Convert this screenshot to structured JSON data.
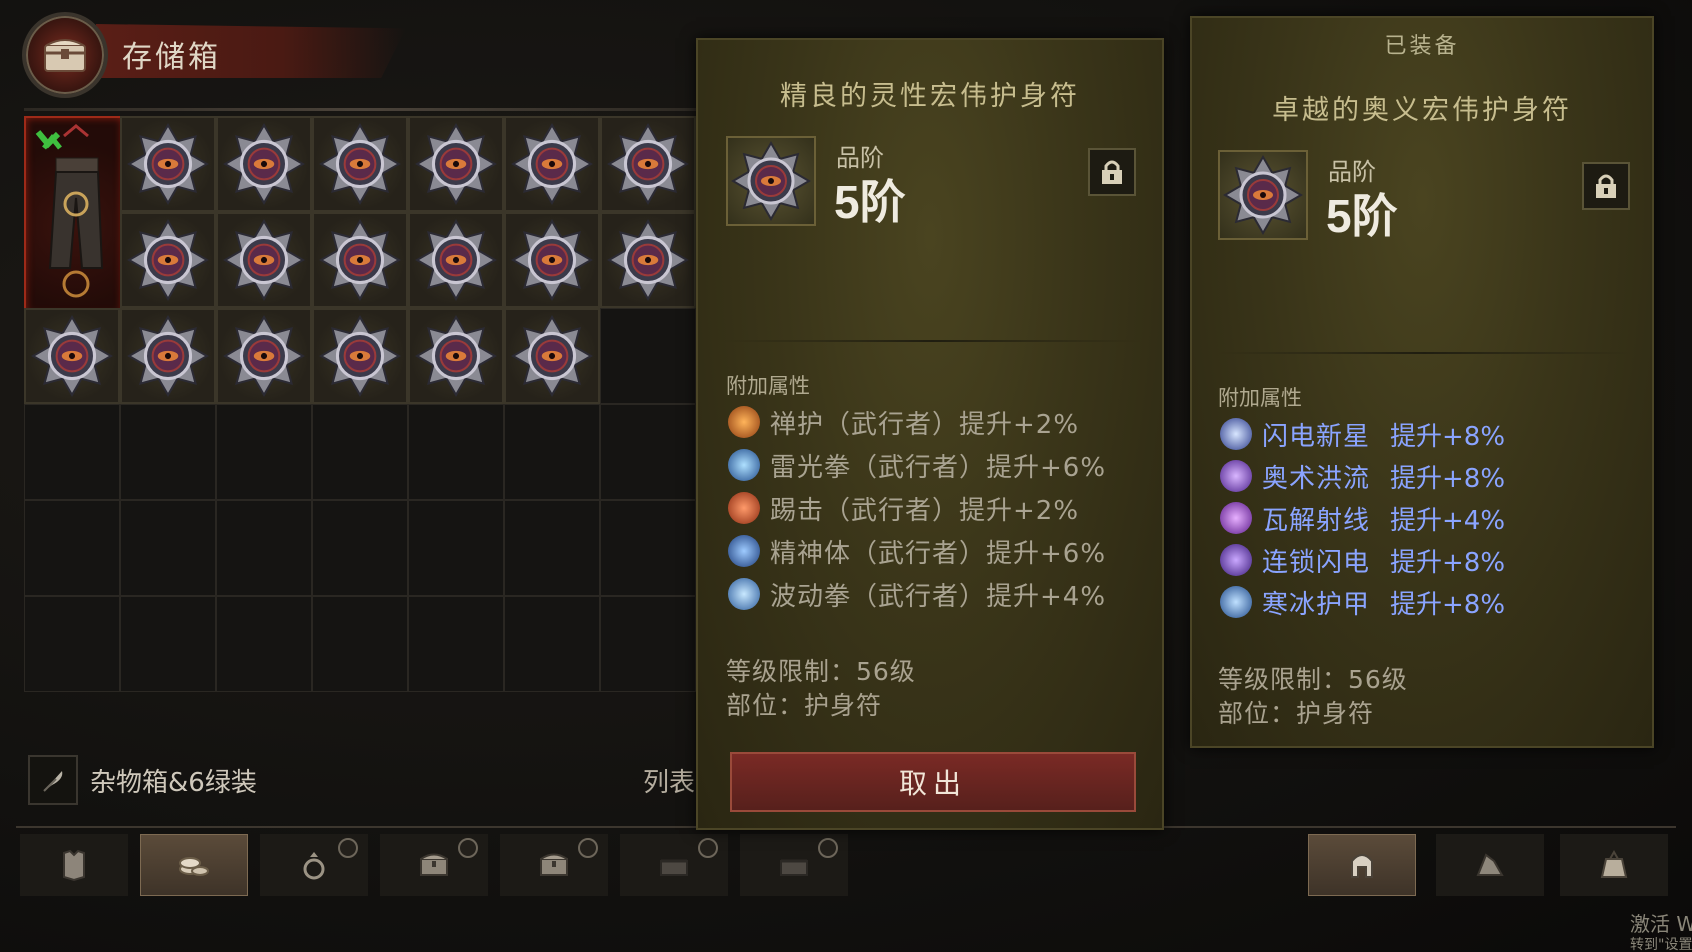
{
  "stash": {
    "title": "存储箱",
    "tab_name": "杂物箱&6绿装",
    "list_label": "列表"
  },
  "selected_item": {
    "name": "精良的灵性宏伟护身符",
    "tier_label": "品阶",
    "tier_value": "5阶",
    "affix_header": "附加属性",
    "affixes": [
      {
        "text": "禅护（武行者）提升+2%",
        "icon": "zen-guard-icon"
      },
      {
        "text": "雷光拳（武行者）提升+6%",
        "icon": "lightning-fist-icon"
      },
      {
        "text": "踢击（武行者）提升+2%",
        "icon": "kick-icon"
      },
      {
        "text": "精神体（武行者）提升+6%",
        "icon": "spirit-body-icon"
      },
      {
        "text": "波动拳（武行者）提升+4%",
        "icon": "wave-fist-icon"
      }
    ],
    "level_req": "等级限制：56级",
    "slot": "部位：护身符",
    "take_out_label": "取出"
  },
  "equipped_item": {
    "header": "已装备",
    "name": "卓越的奥义宏伟护身符",
    "tier_label": "品阶",
    "tier_value": "5阶",
    "affix_header": "附加属性",
    "affixes": [
      {
        "name": "闪电新星",
        "value": "提升+8%",
        "icon": "lightning-nova-icon"
      },
      {
        "name": "奥术洪流",
        "value": "提升+8%",
        "icon": "arcane-torrent-icon"
      },
      {
        "name": "瓦解射线",
        "value": "提升+4%",
        "icon": "disintegrate-icon"
      },
      {
        "name": "连锁闪电",
        "value": "提升+8%",
        "icon": "chain-lightning-icon"
      },
      {
        "name": "寒冰护甲",
        "value": "提升+8%",
        "icon": "frost-armor-icon"
      }
    ],
    "level_req": "等级限制：56级",
    "slot": "部位：护身符"
  },
  "bottom_tabs": [
    {
      "icon": "armor-icon",
      "active": false,
      "locked": false
    },
    {
      "icon": "coin-stack-icon",
      "active": true,
      "locked": false
    },
    {
      "icon": "ring-icon",
      "active": false,
      "locked": true
    },
    {
      "icon": "chest-icon",
      "active": false,
      "locked": true
    },
    {
      "icon": "chest-icon",
      "active": false,
      "locked": true
    },
    {
      "icon": "chest-locked-icon",
      "active": false,
      "locked": true
    },
    {
      "icon": "chest-locked-icon",
      "active": false,
      "locked": true
    }
  ],
  "right_tabs": [
    {
      "icon": "helmet-icon",
      "active": true
    },
    {
      "icon": "materials-icon",
      "active": false
    },
    {
      "icon": "bag-icon",
      "active": false
    }
  ],
  "watermark": {
    "line1": "激活 W",
    "line2": "转到\"设置"
  },
  "colors": {
    "panel_bg": "#3a3519",
    "affix_blue": "#8aa4ff",
    "affix_gray": "#a9a391",
    "take_out_red": "#7a2a25",
    "legendary_border": "#9e2a18"
  }
}
